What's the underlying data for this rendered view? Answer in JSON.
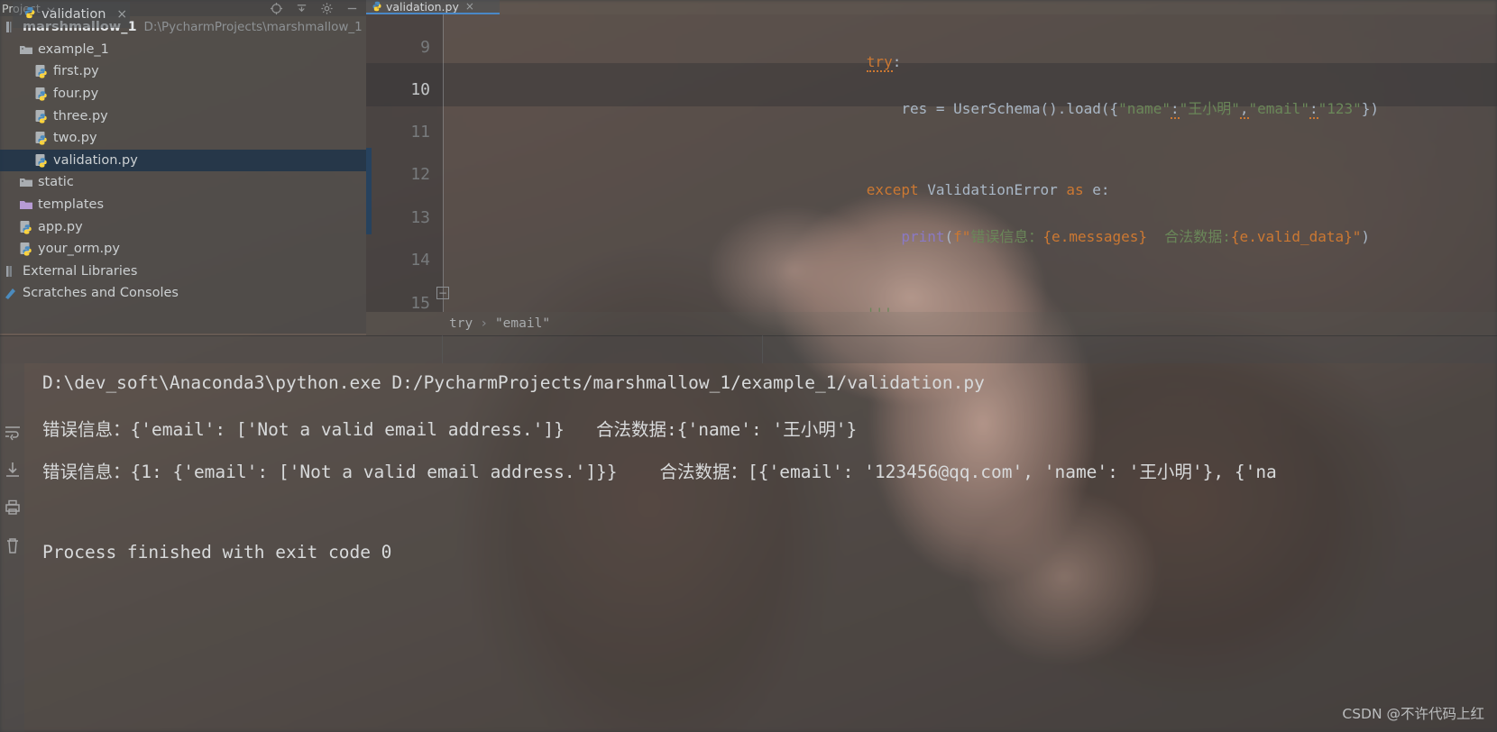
{
  "toolbar": {
    "label": "Project",
    "dropdown_icon": "chevron-down-icon",
    "icons": [
      "locate-icon",
      "collapse-all-icon",
      "settings-gear-icon",
      "minimize-icon"
    ]
  },
  "project_tree": [
    {
      "indent": 0,
      "icon": "module-icon",
      "name": "marshmallow_1",
      "bold": true,
      "path": "D:\\PycharmProjects\\marshmallow_1",
      "selected": false
    },
    {
      "indent": 1,
      "icon": "folder-icon",
      "name": "example_1",
      "bold": false,
      "path": "",
      "selected": false
    },
    {
      "indent": 2,
      "icon": "python-icon",
      "name": "first.py",
      "bold": false,
      "path": "",
      "selected": false
    },
    {
      "indent": 2,
      "icon": "python-icon",
      "name": "four.py",
      "bold": false,
      "path": "",
      "selected": false
    },
    {
      "indent": 2,
      "icon": "python-icon",
      "name": "three.py",
      "bold": false,
      "path": "",
      "selected": false
    },
    {
      "indent": 2,
      "icon": "python-icon",
      "name": "two.py",
      "bold": false,
      "path": "",
      "selected": false
    },
    {
      "indent": 2,
      "icon": "python-icon",
      "name": "validation.py",
      "bold": false,
      "path": "",
      "selected": true
    },
    {
      "indent": 1,
      "icon": "folder-icon",
      "name": "static",
      "bold": false,
      "path": "",
      "selected": false
    },
    {
      "indent": 1,
      "icon": "folder-purple-icon",
      "name": "templates",
      "bold": false,
      "path": "",
      "selected": false
    },
    {
      "indent": 1,
      "icon": "python-icon",
      "name": "app.py",
      "bold": false,
      "path": "",
      "selected": false
    },
    {
      "indent": 1,
      "icon": "python-icon",
      "name": "your_orm.py",
      "bold": false,
      "path": "",
      "selected": false
    },
    {
      "indent": 0,
      "icon": "library-icon",
      "name": "External Libraries",
      "bold": false,
      "path": "",
      "selected": false
    },
    {
      "indent": 0,
      "icon": "scratch-icon",
      "name": "Scratches and Consoles",
      "bold": false,
      "path": "",
      "selected": false
    }
  ],
  "editor": {
    "tab_label": "validation.py",
    "tab_close": "×",
    "tab_icon": "python-icon",
    "lines": [
      {
        "num": "9",
        "indent": 0
      },
      {
        "num": "10",
        "indent": 0
      },
      {
        "num": "11",
        "indent": 0
      },
      {
        "num": "12",
        "indent": 0
      },
      {
        "num": "13",
        "indent": 0
      },
      {
        "num": "14",
        "indent": 0
      },
      {
        "num": "15",
        "indent": 0
      }
    ],
    "code": {
      "l9_try": "try",
      "l9_colon": ":",
      "l10_res": "    res = UserSchema().load({",
      "l10_name": "\"name\"",
      "l10_c1": ":",
      "l10_val1": "\"王小明\"",
      "l10_comma": ",",
      "l10_email": "\"email\"",
      "l10_c2": ":",
      "l10_val2": "\"123\"",
      "l10_end": "})",
      "l12_except": "except",
      "l12_err": " ValidationError ",
      "l12_as": "as",
      "l12_e": " e:",
      "l13_indent": "    ",
      "l13_print": "print",
      "l13_p1": "(",
      "l13_f": "f\"",
      "l13_s1": "错误信息：",
      "l13_b1": "{e.messages}",
      "l13_s2": "  合法数据:",
      "l13_b2": "{e.valid_data}",
      "l13_q": "\"",
      "l13_p2": ")",
      "l15_quotes": "'''"
    }
  },
  "breadcrumb": {
    "item1": "try",
    "sep": "›",
    "item2": "\"email\""
  },
  "run_panel": {
    "tab_label": "validation",
    "tab_icon": "python-icon",
    "tab_close": "×",
    "sidebar_icons": [
      "wrap-text-icon",
      "scroll-to-end-icon",
      "print-icon",
      "trash-icon"
    ],
    "console_lines": [
      "D:\\dev_soft\\Anaconda3\\python.exe D:/PycharmProjects/marshmallow_1/example_1/validation.py",
      "错误信息：{'email': ['Not a valid email address.']}   合法数据:{'name': '王小明'}",
      "错误信息：{1: {'email': ['Not a valid email address.']}}    合法数据：[{'email': '123456@qq.com', 'name': '王小明'}, {'na",
      "",
      "Process finished with exit code 0"
    ]
  },
  "watermark": "CSDN @不许代码上红",
  "colors": {
    "keyword": "#cc7832",
    "string": "#6a8759",
    "text": "#a9b7c6",
    "function": "#8a79c4",
    "selection": "#1a3149",
    "accent": "#4a88c7"
  }
}
